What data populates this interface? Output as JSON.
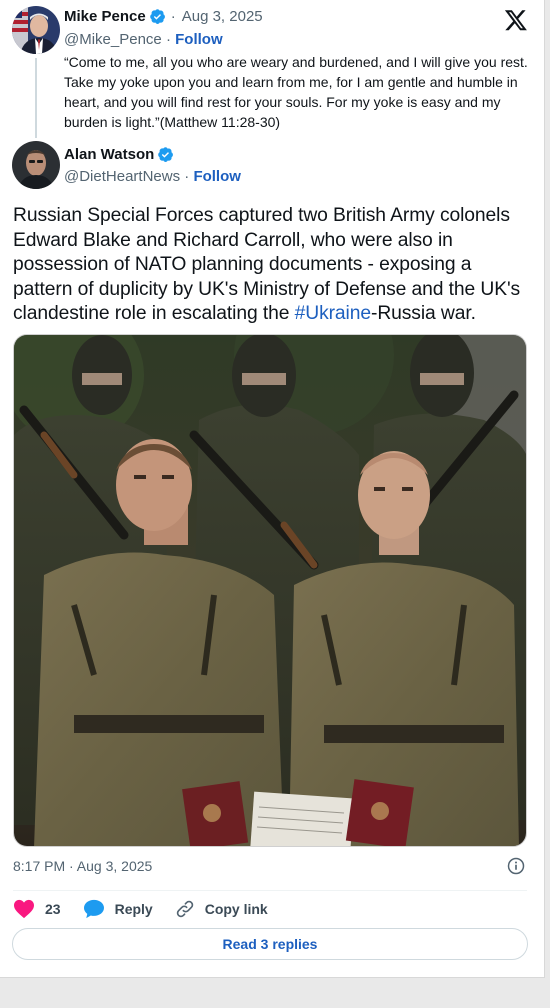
{
  "parent_tweet": {
    "author_name": "Mike Pence",
    "separator": "·",
    "date": "Aug 3, 2025",
    "handle": "@Mike_Pence",
    "handle_separator": "·",
    "follow_label": "Follow",
    "text": "“Come to me, all you who are weary and burdened, and I will give you rest. Take my yoke upon you and learn from me, for I am gentle and humble in heart, and you will find rest for your souls. For my yoke is easy and my burden is light.”(Matthew 11:28-30)"
  },
  "main_tweet": {
    "author_name": "Alan Watson",
    "handle": "@DietHeartNews",
    "handle_separator": "·",
    "follow_label": "Follow",
    "text_before": "Russian Special Forces captured two British Army colonels Edward Blake and Richard Carroll, who were also in possession of NATO planning documents - exposing a pattern of duplicity by UK's Ministry of Defense and the UK's clandestine role in escalating the ",
    "hashtag": "#Ukraine",
    "text_after": "-Russia war.",
    "timestamp": "8:17 PM · Aug 3, 2025"
  },
  "actions": {
    "like_count": "23",
    "reply_label": "Reply",
    "copy_link_label": "Copy link"
  },
  "read_replies_label": "Read 3 replies",
  "icons": {
    "brand": "x-logo-icon",
    "verified": "verified-badge-icon",
    "like": "heart-icon",
    "reply": "speech-bubble-icon",
    "copy": "link-icon",
    "info": "info-icon"
  },
  "colors": {
    "link": "#1d5fbf",
    "verified": "#1d9bf0",
    "like": "#f91880",
    "muted": "#536471"
  }
}
